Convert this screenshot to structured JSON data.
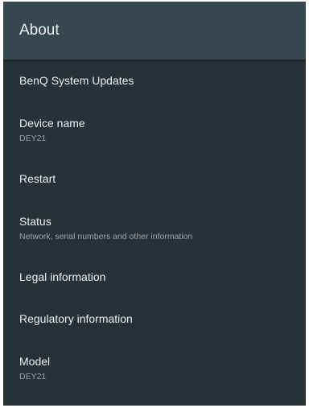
{
  "header": {
    "title": "About"
  },
  "items": [
    {
      "title": "BenQ System Updates",
      "summary": ""
    },
    {
      "title": "Device name",
      "summary": "DEY21"
    },
    {
      "title": "Restart",
      "summary": ""
    },
    {
      "title": "Status",
      "summary": "Network, serial numbers and other information"
    },
    {
      "title": "Legal information",
      "summary": ""
    },
    {
      "title": "Regulatory information",
      "summary": ""
    },
    {
      "title": "Model",
      "summary": "DEY21"
    }
  ],
  "colors": {
    "header_bg": "#37474f",
    "body_bg": "#263238",
    "title_text": "#eceff1",
    "summary_text": "#9aa4a9"
  }
}
